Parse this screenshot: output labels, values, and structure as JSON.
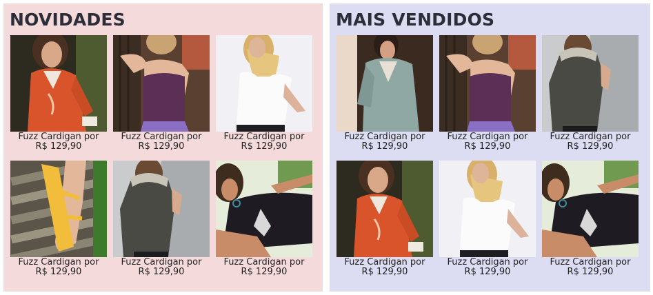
{
  "sections": [
    {
      "title": "NOVIDADES",
      "bg": "#f4dadb",
      "products": [
        {
          "name": "Fuzz Cardigan por",
          "price": "R$ 129,90",
          "image": "orange-cardigan"
        },
        {
          "name": "Fuzz Cardigan por",
          "price": "R$ 129,90",
          "image": "purple-tank"
        },
        {
          "name": "Fuzz Cardigan por",
          "price": "R$ 129,90",
          "image": "white-halter"
        },
        {
          "name": "Fuzz Cardigan por",
          "price": "R$ 129,90",
          "image": "yellow-sandal"
        },
        {
          "name": "Fuzz Cardigan por",
          "price": "R$ 129,90",
          "image": "grey-jacket"
        },
        {
          "name": "Fuzz Cardigan por",
          "price": "R$ 129,90",
          "image": "black-top-lying"
        }
      ]
    },
    {
      "title": "MAIS VENDIDOS",
      "bg": "#dcdcf3",
      "products": [
        {
          "name": "Fuzz Cardigan por",
          "price": "R$ 129,90",
          "image": "teal-blazer"
        },
        {
          "name": "Fuzz Cardigan por",
          "price": "R$ 129,90",
          "image": "purple-tank"
        },
        {
          "name": "Fuzz Cardigan por",
          "price": "R$ 129,90",
          "image": "grey-jacket"
        },
        {
          "name": "Fuzz Cardigan por",
          "price": "R$ 129,90",
          "image": "orange-cardigan"
        },
        {
          "name": "Fuzz Cardigan por",
          "price": "R$ 129,90",
          "image": "white-halter"
        },
        {
          "name": "Fuzz Cardigan por",
          "price": "R$ 129,90",
          "image": "black-top-lying"
        }
      ]
    }
  ]
}
